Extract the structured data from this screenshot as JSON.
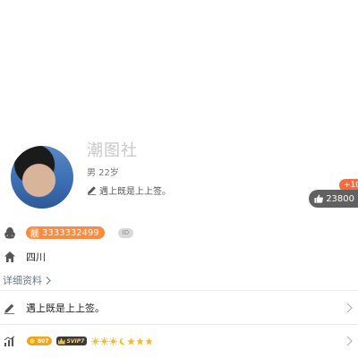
{
  "profile": {
    "name": "潮图社",
    "gender_age": "男 22岁",
    "signature": "遇上既是上上签。"
  },
  "likes": {
    "increment": "+10",
    "count": "23800"
  },
  "info": {
    "qq_prefix": "靓",
    "qq_number": "3333332499",
    "id_tag": "ID",
    "location": "四川",
    "detail_link": "详细资料"
  },
  "menu": {
    "signature_row": "遇上既是上上签。",
    "coin_value": "807",
    "svip_label": "SVIP7"
  },
  "colors": {
    "accent_orange": "#ff8a3d",
    "badge_red": "#ff6a3d",
    "likes_bg": "#616161"
  },
  "icons": [
    "pencil-icon",
    "thumb-up-icon",
    "qq-penguin-icon",
    "home-icon",
    "chevron-right-icon",
    "level-chart-icon",
    "sun-icon",
    "moon-icon",
    "star-icon"
  ]
}
